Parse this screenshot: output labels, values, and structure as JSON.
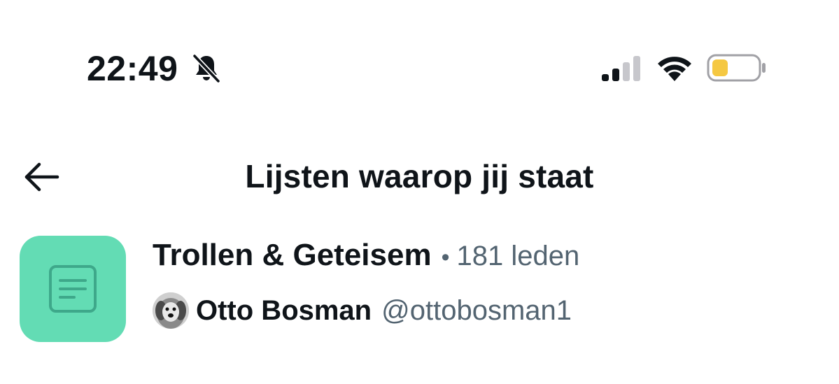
{
  "status_bar": {
    "time": "22:49",
    "icons": [
      "bell-slash-icon",
      "cellular-signal-icon",
      "wifi-icon",
      "battery-icon"
    ],
    "battery_color": "#f5c842",
    "signal_bars_active": 2,
    "signal_bars_total": 4
  },
  "header": {
    "back_icon": "arrow-left-icon",
    "title": "Lijsten waarop jij staat"
  },
  "lists": [
    {
      "name": "Trollen & Geteisem",
      "separator": "•",
      "members": "181 leden",
      "icon": "list-document-icon",
      "icon_bg": "#63dcb4",
      "owner": {
        "name": "Otto Bosman",
        "handle": "@ottobosman1",
        "avatar": "dog-avatar"
      }
    }
  ],
  "colors": {
    "text_primary": "#0f1419",
    "text_secondary": "#536471"
  }
}
